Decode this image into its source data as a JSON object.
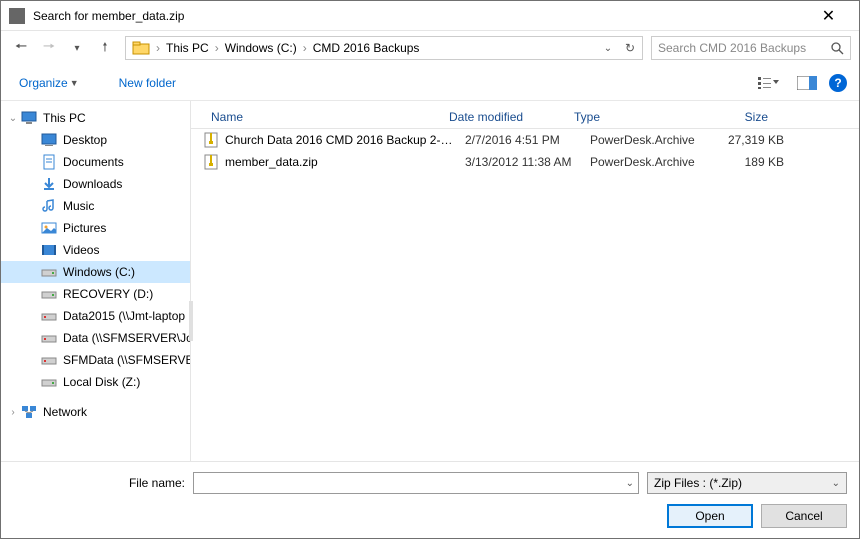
{
  "window": {
    "title": "Search for member_data.zip"
  },
  "breadcrumbs": [
    "This PC",
    "Windows (C:)",
    "CMD 2016 Backups"
  ],
  "search_placeholder": "Search CMD 2016 Backups",
  "toolbar": {
    "organize": "Organize",
    "new_folder": "New folder"
  },
  "tree": {
    "root": "This PC",
    "children": [
      {
        "label": "Desktop",
        "color": "#3a87d6"
      },
      {
        "label": "Documents",
        "color": "#3a87d6"
      },
      {
        "label": "Downloads",
        "color": "#3a87d6"
      },
      {
        "label": "Music",
        "color": "#3a87d6"
      },
      {
        "label": "Pictures",
        "color": "#3a87d6"
      },
      {
        "label": "Videos",
        "color": "#3a87d6"
      },
      {
        "label": "Windows (C:)",
        "selected": true
      },
      {
        "label": "RECOVERY (D:)"
      },
      {
        "label": "Data2015 (\\\\Jmt-laptop"
      },
      {
        "label": "Data (\\\\SFMSERVER\\Jo"
      },
      {
        "label": "SFMData (\\\\SFMSERVE"
      },
      {
        "label": "Local Disk (Z:)"
      }
    ],
    "network": "Network"
  },
  "columns": {
    "name": "Name",
    "date": "Date modified",
    "type": "Type",
    "size": "Size"
  },
  "files": [
    {
      "name": "Church Data 2016 CMD 2016 Backup 2-7-...",
      "date": "2/7/2016 4:51 PM",
      "type": "PowerDesk.Archive",
      "size": "27,319 KB"
    },
    {
      "name": "member_data.zip",
      "date": "3/13/2012 11:38 AM",
      "type": "PowerDesk.Archive",
      "size": "189 KB"
    }
  ],
  "filename_label": "File name:",
  "filename_value": "",
  "filter": "Zip Files : (*.Zip)",
  "buttons": {
    "open": "Open",
    "cancel": "Cancel"
  }
}
